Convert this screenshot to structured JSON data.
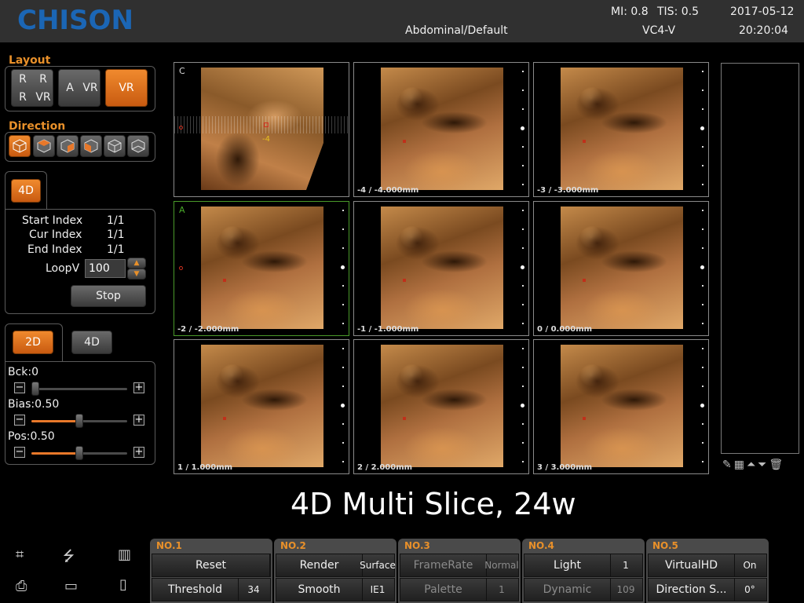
{
  "header": {
    "logo": "CHISON",
    "preset": "Abdominal/Default",
    "mi": "MI:  0.8",
    "tis": "TIS:  0.5",
    "probe": "VC4-V",
    "date": "2017-05-12",
    "time": "20:20:04"
  },
  "layout": {
    "title": "Layout",
    "quad": [
      "R",
      "R",
      "R",
      "VR"
    ],
    "dual": [
      "A",
      "VR"
    ],
    "single": "VR"
  },
  "direction": {
    "title": "Direction",
    "icons": [
      "cube-front-icon",
      "cube-top-icon",
      "cube-right-icon",
      "cube-left-icon",
      "cube-back-icon",
      "cube-bottom-icon"
    ]
  },
  "cine": {
    "tab": "4D",
    "start_label": "Start Index",
    "start_value": "1/1",
    "cur_label": "Cur Index",
    "cur_value": "1/1",
    "end_label": "End Index",
    "end_value": "1/1",
    "loop_label": "LoopV",
    "loop_value": "100",
    "stop": "Stop"
  },
  "mode": {
    "tab_2d": "2D",
    "tab_4d": "4D",
    "bck_label": "Bck:0",
    "bck_level": 0.0,
    "bias_label": "Bias:0.50",
    "bias_level": 0.5,
    "pos_label": "Pos:0.50",
    "pos_level": 0.5
  },
  "slices": [
    {
      "letter": "C",
      "label": "",
      "color": "#dddddd"
    },
    {
      "letter": "",
      "label": "-4 / -4.000mm"
    },
    {
      "letter": "",
      "label": "-3 / -3.000mm"
    },
    {
      "letter": "A",
      "label": "-2 / -2.000mm",
      "color": "#4aaa2a"
    },
    {
      "letter": "",
      "label": "-1 / -1.000mm"
    },
    {
      "letter": "",
      "label": "0 / 0.000mm"
    },
    {
      "letter": "",
      "label": "1 / 1.000mm"
    },
    {
      "letter": "",
      "label": "2 / 2.000mm"
    },
    {
      "letter": "",
      "label": "3 / 3.000mm"
    }
  ],
  "cview_marker": "-4",
  "caption": "4D Multi Slice,  24w",
  "softkeys": [
    {
      "title": "NO.1",
      "r1": "Reset",
      "r1v": "",
      "r2": "Threshold",
      "r2v": "34"
    },
    {
      "title": "NO.2",
      "r1": "Render",
      "r1v": "Surface",
      "r2": "Smooth",
      "r2v": "IE1"
    },
    {
      "title": "NO.3",
      "r1": "FrameRate",
      "r1v": "Normal",
      "r2": "Palette",
      "r2v": "1"
    },
    {
      "title": "NO.4",
      "r1": "Light",
      "r1v": "1",
      "r2": "Dynamic",
      "r2v": "109"
    },
    {
      "title": "NO.5",
      "r1": "VirtualHD",
      "r1v": "On",
      "r2": "Direction S...",
      "r2v": "0°"
    }
  ]
}
